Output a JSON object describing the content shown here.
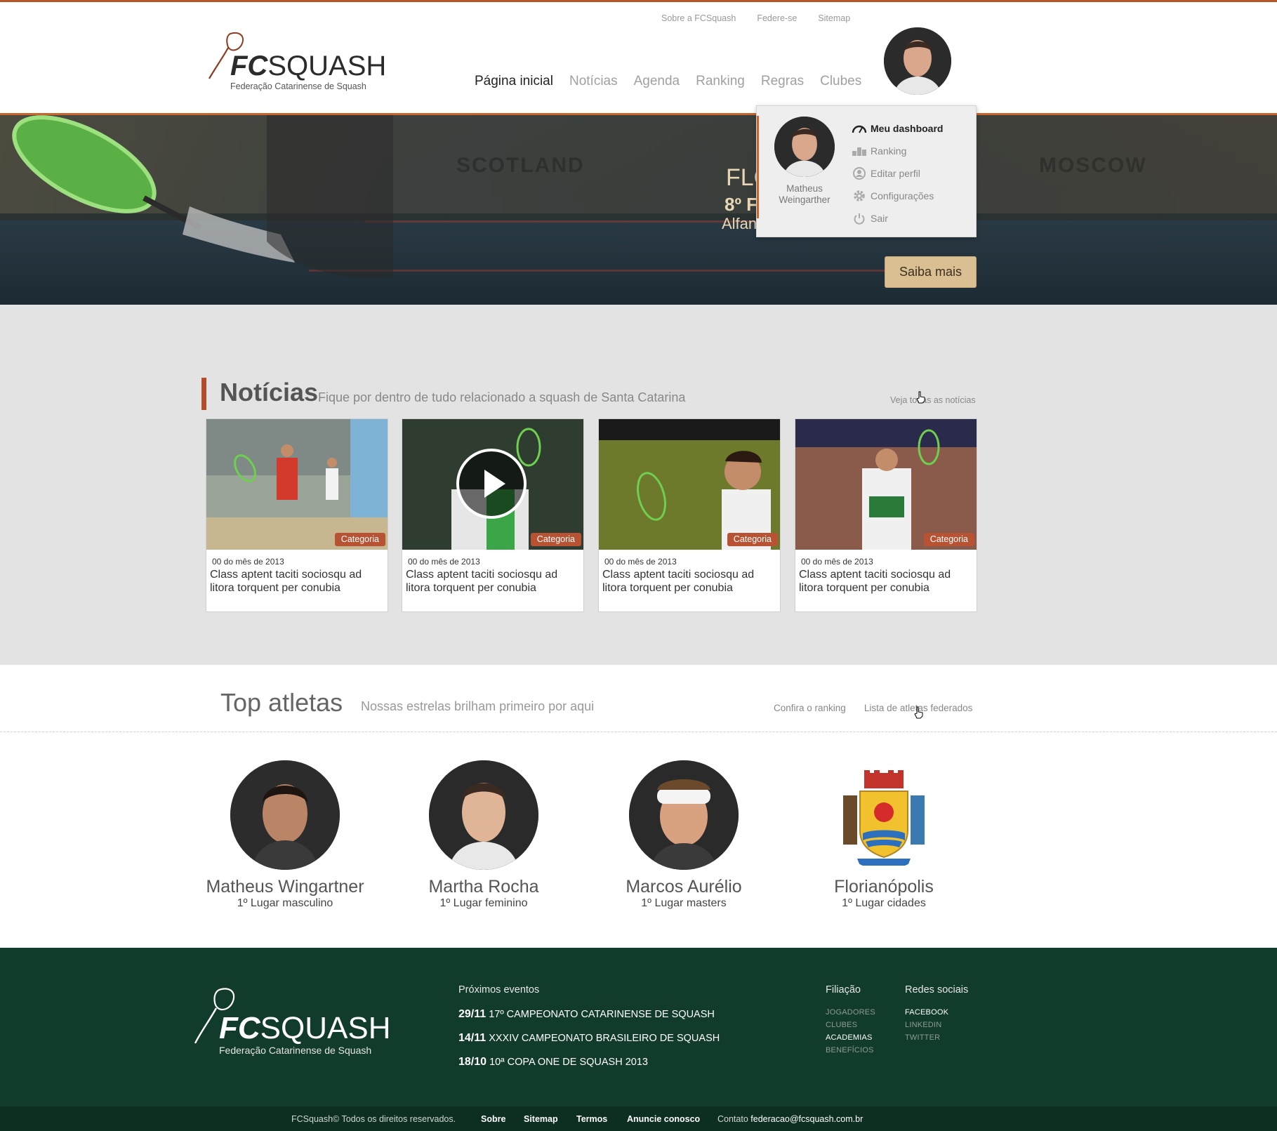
{
  "header": {
    "logo_brand_bold": "FC",
    "logo_brand_rest": "SQUASH",
    "logo_subtitle": "Federação Catarinense de Squash",
    "util_links": [
      "Sobre a FCSquash",
      "Federe-se",
      "Sitemap"
    ],
    "nav": [
      "Página inicial",
      "Notícias",
      "Agenda",
      "Ranking",
      "Regras",
      "Clubes"
    ],
    "active_nav": "Página inicial"
  },
  "hero": {
    "title": "FLO",
    "subtitle": "8º F",
    "location": "Alfan",
    "button_label": "Saiba mais",
    "wall_texts": [
      "SCOTLAND",
      "MOSCOW"
    ]
  },
  "user_menu": {
    "name": "Matheus Weingarther",
    "items": [
      {
        "label": "Meu dashboard",
        "icon": "dashboard-icon"
      },
      {
        "label": "Ranking",
        "icon": "ranking-icon"
      },
      {
        "label": "Editar perfil",
        "icon": "edit-profile-icon"
      },
      {
        "label": "Configurações",
        "icon": "gear-icon"
      },
      {
        "label": "Sair",
        "icon": "power-icon"
      }
    ]
  },
  "news": {
    "title": "Notícias",
    "subtitle": "Fique por dentro de tudo relacionado a squash de Santa Catarina",
    "more_link": "Veja todas as notícias",
    "cards": [
      {
        "category": "Categoria",
        "date": "00 do mês de 2013",
        "text": "Class aptent taciti sociosqu ad litora torquent per conubia",
        "video": false
      },
      {
        "category": "Categoria",
        "date": "00 do mês de 2013",
        "text": "Class aptent taciti sociosqu ad litora torquent per conubia",
        "video": true
      },
      {
        "category": "Categoria",
        "date": "00 do mês de 2013",
        "text": "Class aptent taciti sociosqu ad litora torquent per conubia",
        "video": false
      },
      {
        "category": "Categoria",
        "date": "00 do mês de 2013",
        "text": "Class aptent taciti sociosqu ad litora torquent per conubia",
        "video": false
      }
    ]
  },
  "top_athletes": {
    "title": "Top atletas",
    "subtitle": "Nossas estrelas brilham primeiro por aqui",
    "links": [
      "Confira o ranking",
      "Lista de atletas federados"
    ],
    "athletes": [
      {
        "name": "Matheus Wingartner",
        "place": "1º Lugar masculino"
      },
      {
        "name": "Martha Rocha",
        "place": "1º Lugar feminino"
      },
      {
        "name": "Marcos Aurélio",
        "place": "1º Lugar masters"
      },
      {
        "name": "Florianópolis",
        "place": "1º Lugar cidades"
      }
    ]
  },
  "footer": {
    "logo_brand_bold": "FC",
    "logo_brand_rest": "SQUASH",
    "logo_subtitle": "Federação Catarinense de Squash",
    "events_title": "Próximos eventos",
    "events": [
      {
        "date": "29/11",
        "name": "17º CAMPEONATO CATARINENSE DE SQUASH"
      },
      {
        "date": "14/11",
        "name": "XXXIV CAMPEONATO BRASILEIRO DE SQUASH"
      },
      {
        "date": "18/10",
        "name": "10ª COPA ONE DE SQUASH 2013"
      }
    ],
    "filiacao_title": "Filiação",
    "filiacao": [
      "JOGADORES",
      "CLUBES",
      "ACADEMIAS",
      "BENEFÍCIOS"
    ],
    "social_title": "Redes sociais",
    "social": [
      "FACEBOOK",
      "LINKEDIN",
      "TWITTER"
    ],
    "copyright": "FCSquash©  Todos os direitos reservados.",
    "bottom_links": [
      "Sobre",
      "Sitemap",
      "Termos",
      "Anuncie conosco"
    ],
    "contact_label": "Contato",
    "contact_email": "federacao@fcsquash.com.br"
  },
  "colors": {
    "accent": "#c8662e",
    "category_badge": "#b75333",
    "footer_bg": "#113b2b",
    "hero_button": "#d9bf91"
  }
}
